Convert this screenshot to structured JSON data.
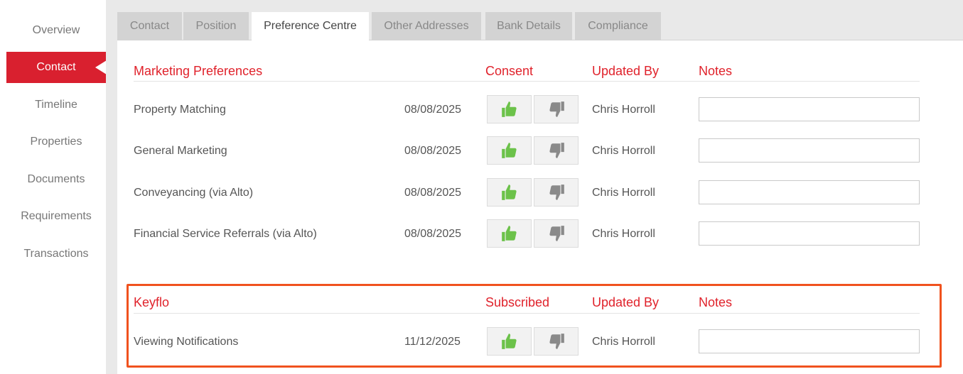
{
  "sidebar": {
    "items": [
      {
        "label": "Overview",
        "active": false
      },
      {
        "label": "Contact",
        "active": true
      },
      {
        "label": "Timeline",
        "active": false
      },
      {
        "label": "Properties",
        "active": false
      },
      {
        "label": "Documents",
        "active": false
      },
      {
        "label": "Requirements",
        "active": false
      },
      {
        "label": "Transactions",
        "active": false
      }
    ]
  },
  "tabs": [
    {
      "label": "Contact",
      "active": false
    },
    {
      "label": "Position",
      "active": false
    },
    {
      "label": "Preference Centre",
      "active": true
    },
    {
      "label": "Other Addresses",
      "active": false
    },
    {
      "label": "Bank Details",
      "active": false
    },
    {
      "label": "Compliance",
      "active": false
    }
  ],
  "marketing": {
    "title": "Marketing Preferences",
    "col_consent": "Consent",
    "col_updated_by": "Updated By",
    "col_notes": "Notes",
    "rows": [
      {
        "label": "Property Matching",
        "date": "08/08/2025",
        "updated_by": "Chris Horroll",
        "notes": "",
        "consent": "yes"
      },
      {
        "label": "General Marketing",
        "date": "08/08/2025",
        "updated_by": "Chris Horroll",
        "notes": "",
        "consent": "yes"
      },
      {
        "label": "Conveyancing (via Alto)",
        "date": "08/08/2025",
        "updated_by": "Chris Horroll",
        "notes": "",
        "consent": "yes"
      },
      {
        "label": "Financial Service Referrals (via Alto)",
        "date": "08/08/2025",
        "updated_by": "Chris Horroll",
        "notes": "",
        "consent": "yes"
      }
    ]
  },
  "keyflo": {
    "title": "Keyflo",
    "col_subscribed": "Subscribed",
    "col_updated_by": "Updated By",
    "col_notes": "Notes",
    "rows": [
      {
        "label": "Viewing Notifications",
        "date": "11/12/2025",
        "updated_by": "Chris Horroll",
        "notes": "",
        "consent": "yes"
      }
    ]
  },
  "colors": {
    "accent_red": "#e0222b",
    "sidebar_active": "#d9202f",
    "thumb_up_green": "#6cc24a",
    "thumb_down_grey": "#8a8a8a",
    "highlight_orange": "#f0521e"
  },
  "icons": {
    "consent_yes": "thumbs-up-icon",
    "consent_no": "thumbs-down-icon"
  }
}
